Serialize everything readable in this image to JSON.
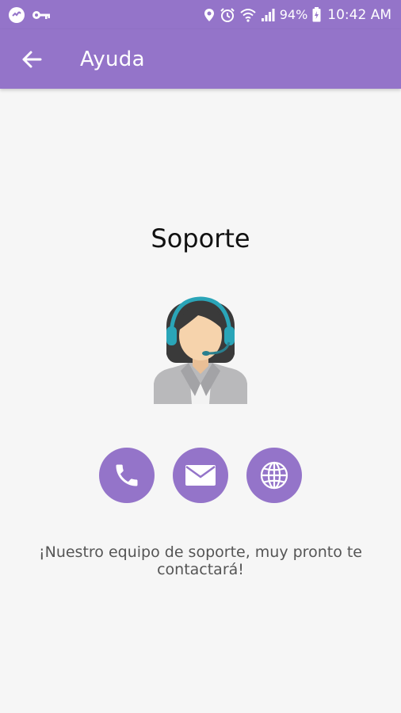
{
  "status_bar": {
    "battery": "94%",
    "time": "10:42 AM",
    "icons": [
      "vpn-badge-icon",
      "key-icon",
      "location-icon",
      "alarm-icon",
      "wifi-icon",
      "signal-icon",
      "battery-icon"
    ]
  },
  "app_bar": {
    "title": "Ayuda",
    "back_icon": "arrow-left-icon"
  },
  "support": {
    "title": "Soporte",
    "illustration": "support-agent-headset",
    "actions": [
      {
        "icon": "phone-icon"
      },
      {
        "icon": "mail-icon"
      },
      {
        "icon": "globe-icon"
      }
    ],
    "message": "¡Nuestro equipo de soporte, muy pronto te contactará!"
  },
  "colors": {
    "primary": "#9474c9",
    "background": "#f6f6f6",
    "headset": "#2aa5b8"
  }
}
